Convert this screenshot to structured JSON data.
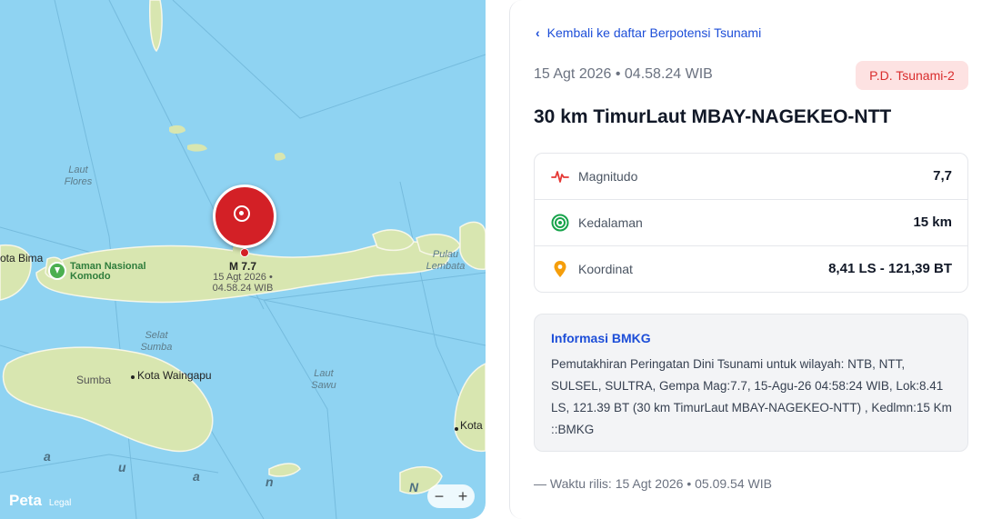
{
  "map": {
    "labels": {
      "laut_flores": "Laut\nFlores",
      "selat_sumba": "Selat\nSumba",
      "laut_sawu": "Laut\nSawu",
      "pulau_lembata": "Pulau\nLembata"
    },
    "places": {
      "bima": "ota Bima",
      "waingapu": "Kota Waingapu",
      "sumba": "Sumba",
      "kota_right": "Kota"
    },
    "park": "Taman Nasional\nKomodo",
    "sea_letters": [
      "a",
      "u",
      "a",
      "n",
      "N"
    ],
    "quake": {
      "magnitude": "M 7.7",
      "date": "15 Agt 2026 •",
      "time": "04.58.24 WIB",
      "color": "#d32026"
    },
    "attribution": "Peta",
    "legal": "Legal",
    "zoom_out": "−",
    "zoom_in": "+"
  },
  "panel": {
    "back_link": "Kembali ke daftar Berpotensi Tsunami",
    "datetime": "15 Agt 2026 • 04.58.24 WIB",
    "badge": "P.D. Tsunami-2",
    "title": "30 km TimurLaut MBAY-NAGEKEO-NTT",
    "info": {
      "magnitude_label": "Magnitudo",
      "magnitude_value": "7,7",
      "depth_label": "Kedalaman",
      "depth_value": "15 km",
      "coord_label": "Koordinat",
      "coord_value": "8,41 LS - 121,39 BT"
    },
    "bmkg": {
      "title": "Informasi BMKG",
      "text": "Pemutakhiran Peringatan Dini Tsunami untuk wilayah: NTB, NTT, SULSEL, SULTRA, Gempa Mag:7.7, 15-Agu-26 04:58:24 WIB, Lok:8.41 LS, 121.39 BT (30 km TimurLaut MBAY-NAGEKEO-NTT) , Kedlmn:15 Km ::BMKG"
    },
    "release": "— Waktu rilis: 15 Agt 2026 • 05.09.54 WIB",
    "colors": {
      "accent": "#1d4ed8",
      "badge_bg": "#fde2e2",
      "badge_fg": "#d92d2d"
    }
  }
}
